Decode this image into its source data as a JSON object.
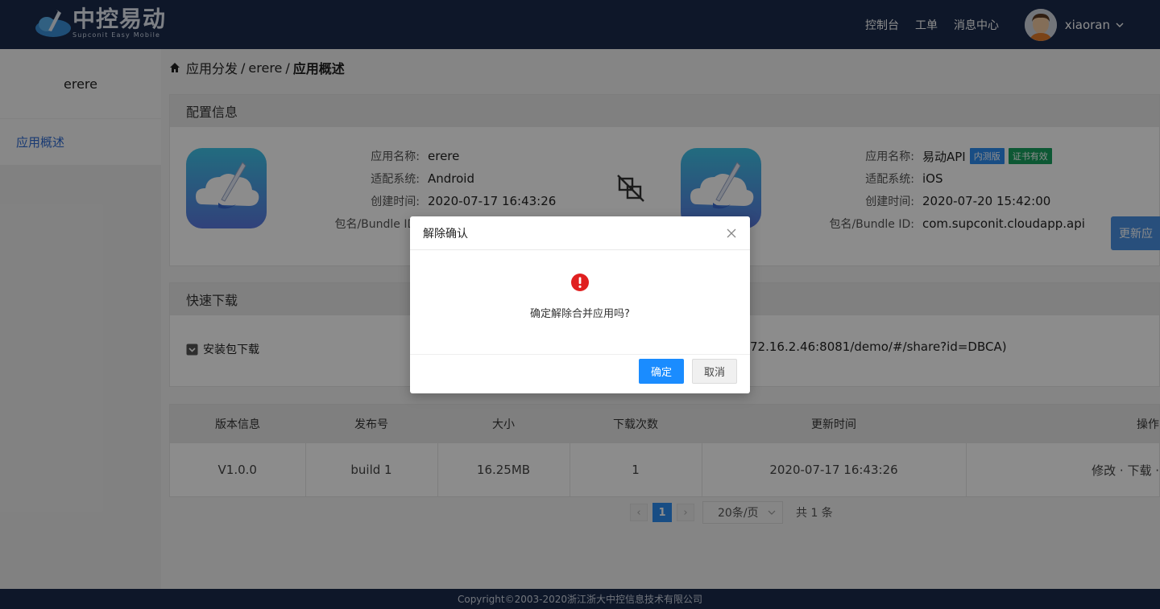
{
  "header": {
    "logo_title": "中控易动",
    "logo_sub": "Supconit Easy Mobile",
    "nav": [
      "控制台",
      "工单",
      "消息中心"
    ],
    "username": "xiaoran"
  },
  "sidebar": {
    "title": "erere",
    "items": [
      {
        "label": "应用概述"
      }
    ]
  },
  "breadcrumb": {
    "items": [
      "应用分发",
      "erere",
      "应用概述"
    ],
    "sep": "/"
  },
  "config": {
    "heading": "配置信息",
    "left_app": {
      "rows": [
        {
          "key": "应用名称:",
          "value": "erere"
        },
        {
          "key": "适配系统:",
          "value": "Android"
        },
        {
          "key": "创建时间:",
          "value": "2020-07-17 16:43:26"
        },
        {
          "key": "包名/Bundle ID:",
          "value": ""
        }
      ]
    },
    "right_app": {
      "rows": [
        {
          "key": "应用名称:",
          "value": "易动API"
        },
        {
          "key": "适配系统:",
          "value": "iOS"
        },
        {
          "key": "创建时间:",
          "value": "2020-07-20 15:42:00"
        },
        {
          "key": "包名/Bundle ID:",
          "value": "com.supconit.cloudapp.api"
        }
      ],
      "tags": [
        "内测版",
        "证书有效"
      ]
    },
    "update_button": "更新应"
  },
  "quick": {
    "heading": "快速下载",
    "download_label": "安装包下载",
    "share_url": "72.16.2.46:8081/demo/#/share?id=DBCA)"
  },
  "versions": {
    "columns": [
      "版本信息",
      "发布号",
      "大小",
      "下载次数",
      "更新时间",
      "操作"
    ],
    "rows": [
      {
        "version": "V1.0.0",
        "build": "build 1",
        "size": "16.25MB",
        "downloads": "1",
        "updated": "2020-07-17 16:43:26",
        "ops": "修改 · 下载 ·"
      }
    ]
  },
  "pager": {
    "prev": "‹",
    "current": "1",
    "next": "›",
    "page_size": "20条/页",
    "total": "共 1 条"
  },
  "footer": {
    "copyright": "Copyright©2003-2020浙江浙大中控信息技术有限公司"
  },
  "modal": {
    "title": "解除确认",
    "message": "确定解除合并应用吗?",
    "ok": "确定",
    "cancel": "取消"
  },
  "colors": {
    "header_bg": "#1a2b4c",
    "accent": "#1a8cff",
    "link": "#3a78c9",
    "danger": "#e02020"
  }
}
